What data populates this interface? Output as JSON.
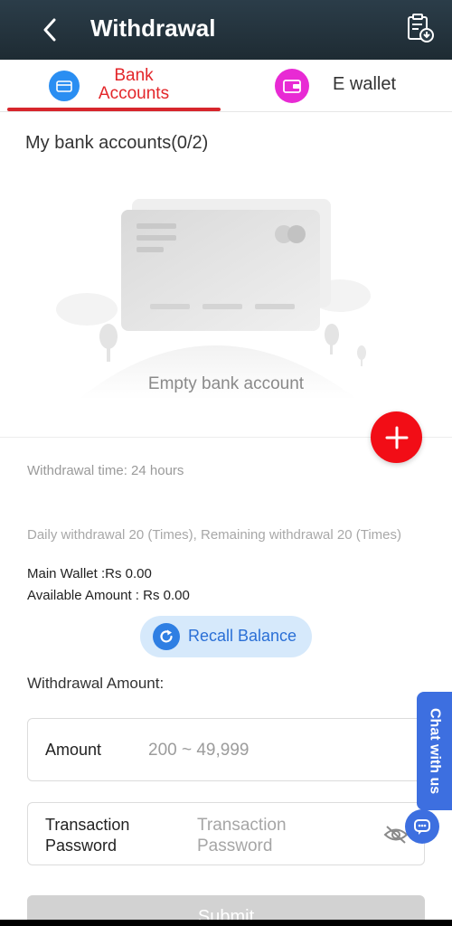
{
  "header": {
    "title": "Withdrawal",
    "back_icon": "chevron-left-icon",
    "record_icon": "clipboard-download-icon"
  },
  "tabs": [
    {
      "label": "Bank Accounts",
      "icon": "bank-card-icon",
      "active": true,
      "color": "#e3262a"
    },
    {
      "label": "E wallet",
      "icon": "wallet-icon",
      "active": false,
      "color": "#333333"
    }
  ],
  "bank_section": {
    "title": "My bank accounts(0/2)",
    "empty_text": "Empty bank account"
  },
  "info": {
    "withdrawal_time": "Withdrawal time:  24 hours",
    "daily_limit": "Daily withdrawal 20 (Times), Remaining withdrawal 20 (Times)",
    "main_wallet": "Main Wallet :Rs 0.00",
    "available_amount": "Available Amount : Rs 0.00"
  },
  "recall": {
    "label": "Recall Balance",
    "icon": "refresh-icon"
  },
  "form": {
    "heading": "Withdrawal Amount:",
    "amount_label": "Amount",
    "amount_placeholder": "200 ~ 49,999",
    "password_label": "Transaction Password",
    "password_placeholder": "Transaction Password"
  },
  "chat": {
    "label": "Chat with us",
    "icon": "chat-bubble-icon"
  },
  "submit": {
    "label": "Submit"
  },
  "colors": {
    "header_bg": "#1e2b33",
    "accent_red": "#e3262a",
    "add_button": "#f20d16",
    "recall_bg": "#d6e9fb",
    "chat_blue": "#3d6fe0"
  }
}
